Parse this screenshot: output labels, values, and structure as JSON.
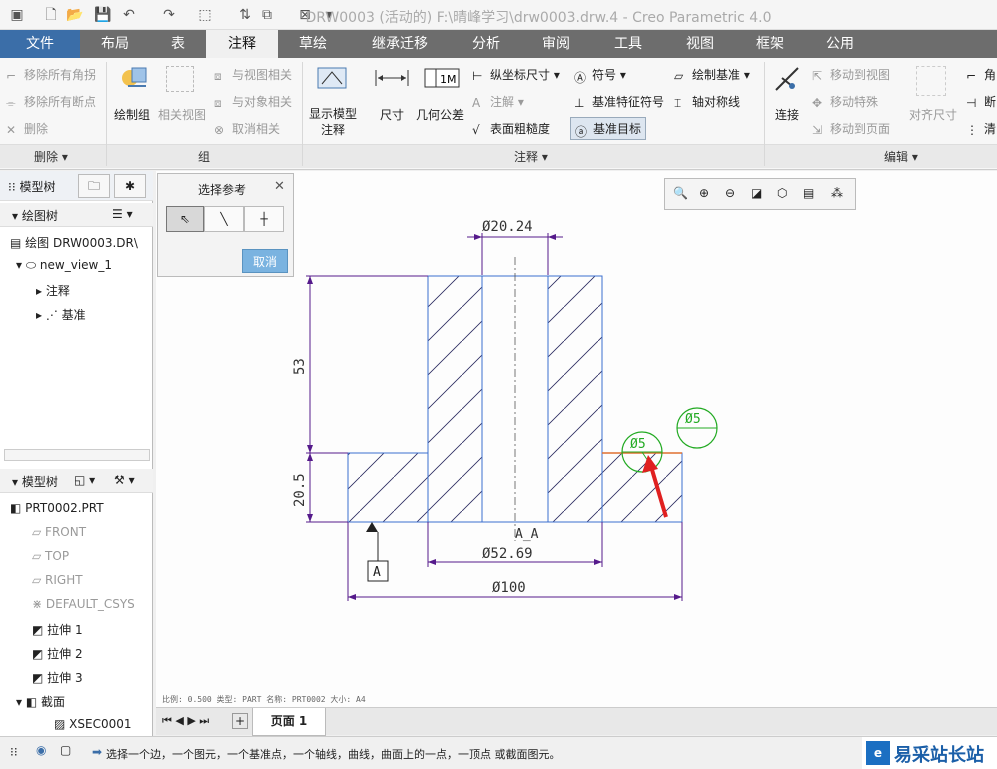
{
  "window": {
    "title": "DRW0003 (活动的) F:\\晴峰学习\\drw0003.drw.4 - Creo Parametric 4.0"
  },
  "tabs": [
    {
      "label": "文件"
    },
    {
      "label": "布局"
    },
    {
      "label": "表"
    },
    {
      "label": "注释"
    },
    {
      "label": "草绘"
    },
    {
      "label": "继承迁移"
    },
    {
      "label": "分析"
    },
    {
      "label": "审阅"
    },
    {
      "label": "工具"
    },
    {
      "label": "视图"
    },
    {
      "label": "框架"
    },
    {
      "label": "公用"
    }
  ],
  "ribbon": {
    "delete_group": {
      "items": [
        "移除所有角拐",
        "移除所有断点",
        "删除"
      ],
      "label": "删除"
    },
    "group_group": {
      "draw_group": "绘制组",
      "related_view": "相关视图",
      "relate_to_view": "与视图相关",
      "relate_to_object": "与对象相关",
      "unrelate": "取消相关",
      "label": "组"
    },
    "annotation_group": {
      "show_model": "显示模型注释",
      "dimension": "尺寸",
      "gtol": "几何公差",
      "ordinate": "纵坐标尺寸",
      "note": "注解",
      "surface_finish": "表面粗糙度",
      "symbol": "符号",
      "datum_feature": "基准特征符号",
      "datum_target": "基准目标",
      "draw_datum": "绘制基准",
      "axis_sym": "轴对称线",
      "label": "注释"
    },
    "edit_group": {
      "connect": "连接",
      "move_to_view": "移动到视图",
      "move_special": "移动特殊",
      "move_to_page": "移动到页面",
      "align_dim": "对齐尺寸",
      "corner": "角",
      "break": "断",
      "clean": "清",
      "label": "编辑"
    }
  },
  "left_panel": {
    "tab_model_tree": "模型树",
    "drawing_tree_label": "绘图树",
    "drawing_tree": [
      "绘图 DRW0003.DR\\",
      "new_view_1",
      "注释",
      "基准"
    ],
    "model_tree_label": "模型树",
    "model_tree": [
      "PRT0002.PRT",
      "FRONT",
      "TOP",
      "RIGHT",
      "DEFAULT_CSYS",
      "拉伸 1",
      "拉伸 2",
      "拉伸 3",
      "截面",
      "XSEC0001"
    ]
  },
  "select_dialog": {
    "title": "选择参考",
    "cancel": "取消"
  },
  "drawing": {
    "dims": {
      "top_bore": "Ø20.24",
      "height_upper": "53",
      "height_lower": "20.5",
      "middle": "Ø52.69",
      "overall": "Ø100",
      "target_a": "Ø5",
      "target_b": "Ø5"
    },
    "section_label": "A_A",
    "datum_label": "A",
    "footer": "比例: 0.500    类型: PART    名称: PRT0002    大小: A4"
  },
  "page_bar": {
    "page": "页面 1"
  },
  "status": {
    "message": "选择一个边，一个图元，一个基准点，一个轴线，曲线，曲面上的一点，一顶点 或截面图元。",
    "brand": "易采站长站"
  }
}
